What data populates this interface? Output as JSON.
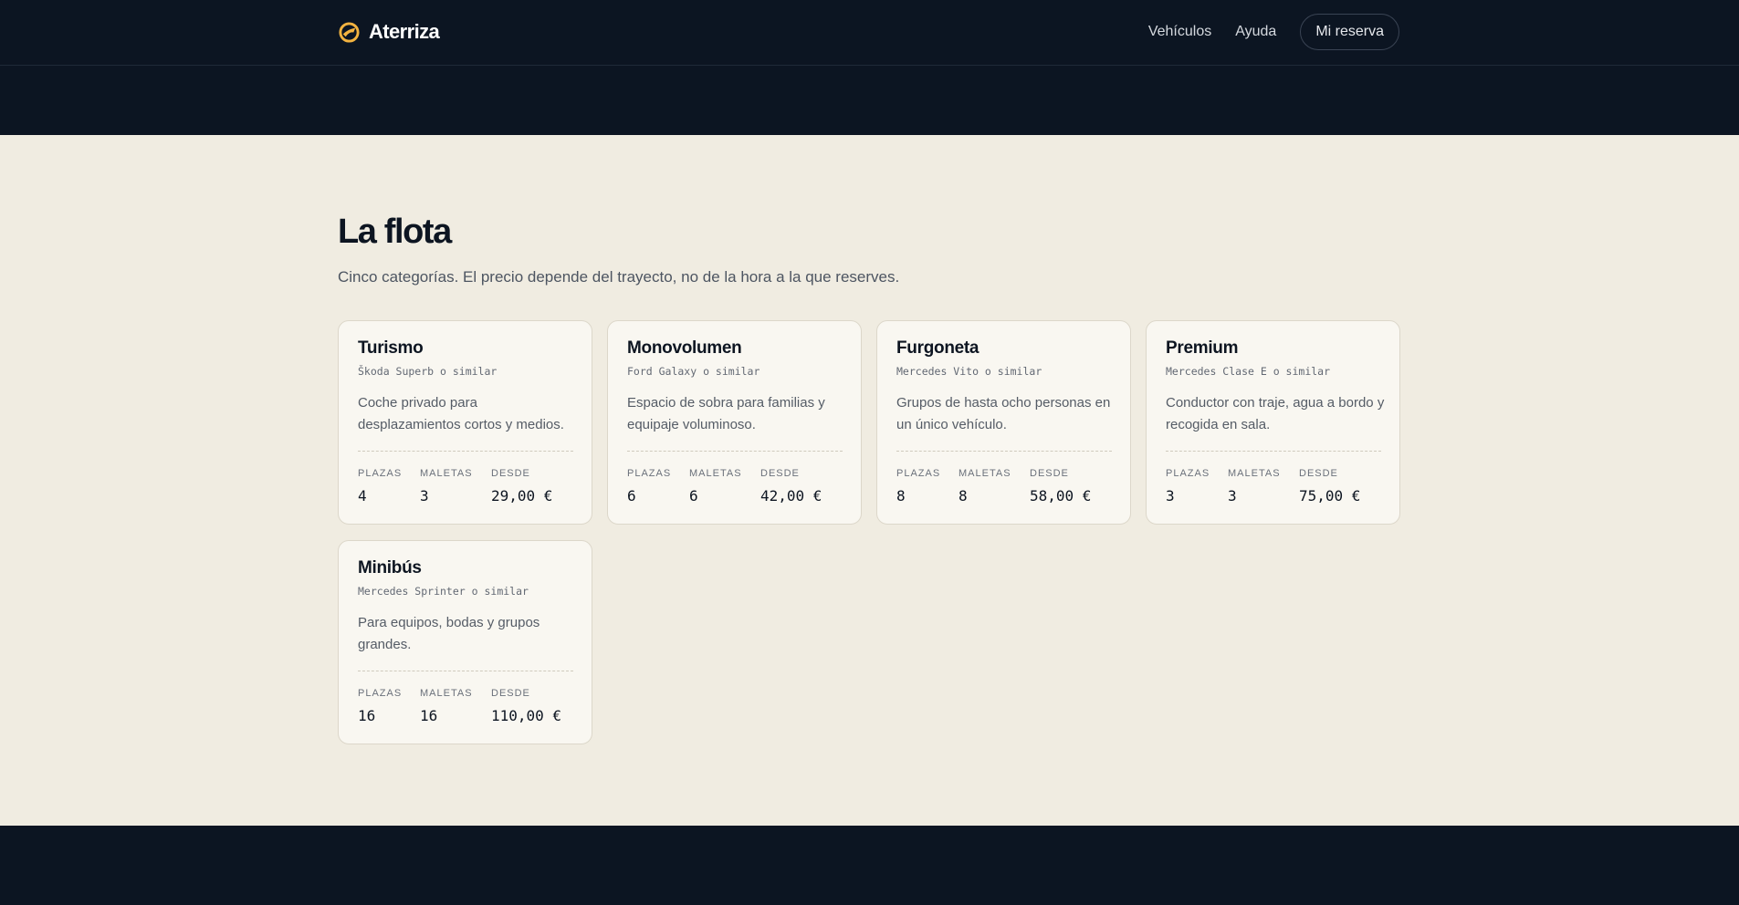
{
  "header": {
    "brand_name": "Aterriza",
    "nav": {
      "vehicles": "Vehículos",
      "help": "Ayuda",
      "booking": "Mi reserva"
    }
  },
  "main": {
    "title": "La flota",
    "subtitle": "Cinco categorías. El precio depende del trayecto, no de la hora a la que reserves."
  },
  "spec_labels": {
    "seats": "PLAZAS",
    "bags": "MALETAS",
    "from": "DESDE"
  },
  "vehicles": [
    {
      "name": "Turismo",
      "model": "Škoda Superb o similar",
      "description": "Coche privado para desplazamientos cortos y medios.",
      "seats": "4",
      "bags": "3",
      "price": "29,00 €"
    },
    {
      "name": "Monovolumen",
      "model": "Ford Galaxy o similar",
      "description": "Espacio de sobra para familias y equipaje voluminoso.",
      "seats": "6",
      "bags": "6",
      "price": "42,00 €"
    },
    {
      "name": "Furgoneta",
      "model": "Mercedes Vito o similar",
      "description": "Grupos de hasta ocho personas en un único vehículo.",
      "seats": "8",
      "bags": "8",
      "price": "58,00 €"
    },
    {
      "name": "Premium",
      "model": "Mercedes Clase E o similar",
      "description": "Conductor con traje, agua a bordo y recogida en sala.",
      "seats": "3",
      "bags": "3",
      "price": "75,00 €"
    },
    {
      "name": "Minibús",
      "model": "Mercedes Sprinter o similar",
      "description": "Para equipos, bodas y grupos grandes.",
      "seats": "16",
      "bags": "16",
      "price": "110,00 €"
    }
  ],
  "colors": {
    "header_bg": "#0c1522",
    "page_bg": "#f0ece1",
    "card_bg": "#f9f7f1",
    "accent": "#f3b340"
  }
}
